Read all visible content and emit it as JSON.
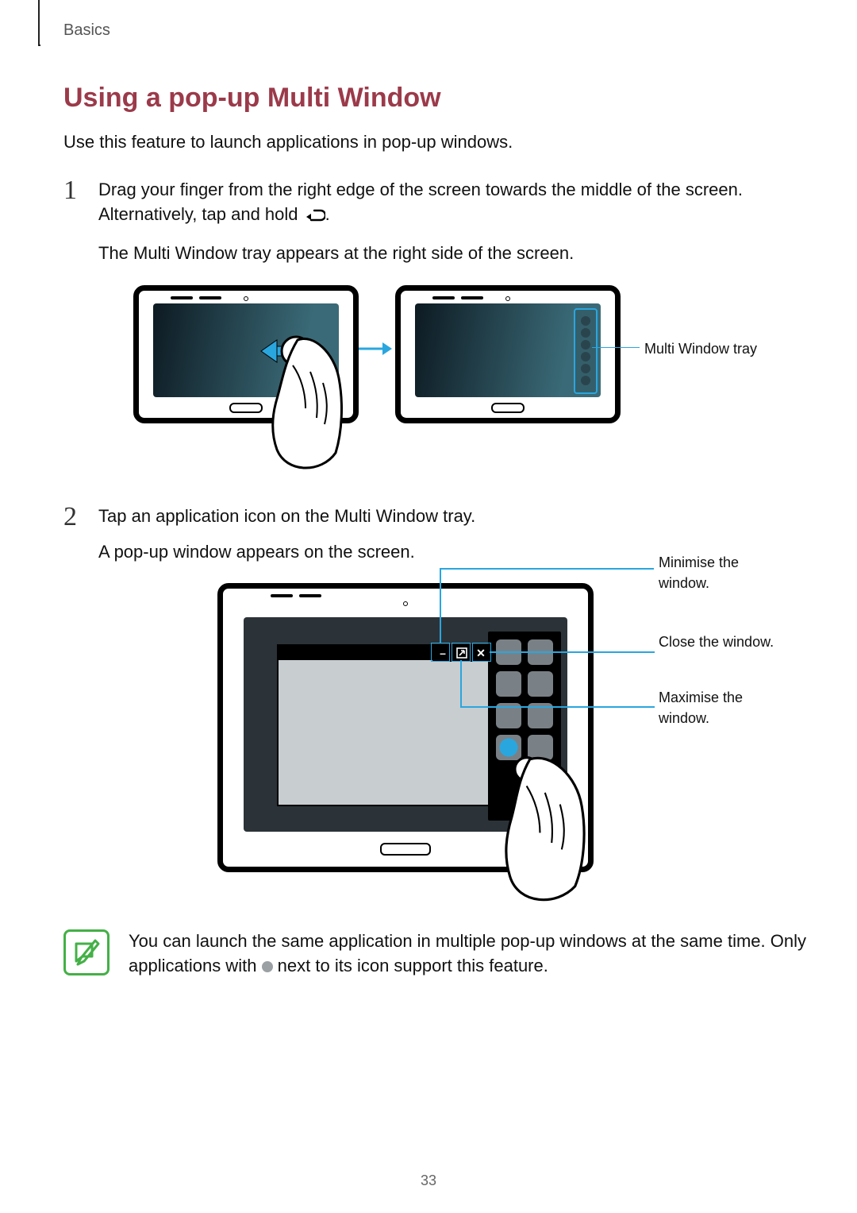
{
  "chapter": "Basics",
  "section_title": "Using a pop-up Multi Window",
  "intro": "Use this feature to launch applications in pop-up windows.",
  "steps": [
    {
      "num": "1",
      "text_a": "Drag your finger from the right edge of the screen towards the middle of the screen. Alternatively, tap and hold ",
      "text_b": ".",
      "sub": "The Multi Window tray appears at the right side of the screen."
    },
    {
      "num": "2",
      "text_a": "Tap an application icon on the Multi Window tray.",
      "sub": "A pop-up window appears on the screen."
    }
  ],
  "callouts": {
    "tray_label": "Multi Window tray",
    "minimise": "Minimise the window.",
    "close": "Close the window.",
    "maximise": "Maximise the window."
  },
  "note": {
    "text_a": "You can launch the same application in multiple pop-up windows at the same time. Only applications with ",
    "text_b": " next to its icon support this feature."
  },
  "page_number": "33"
}
